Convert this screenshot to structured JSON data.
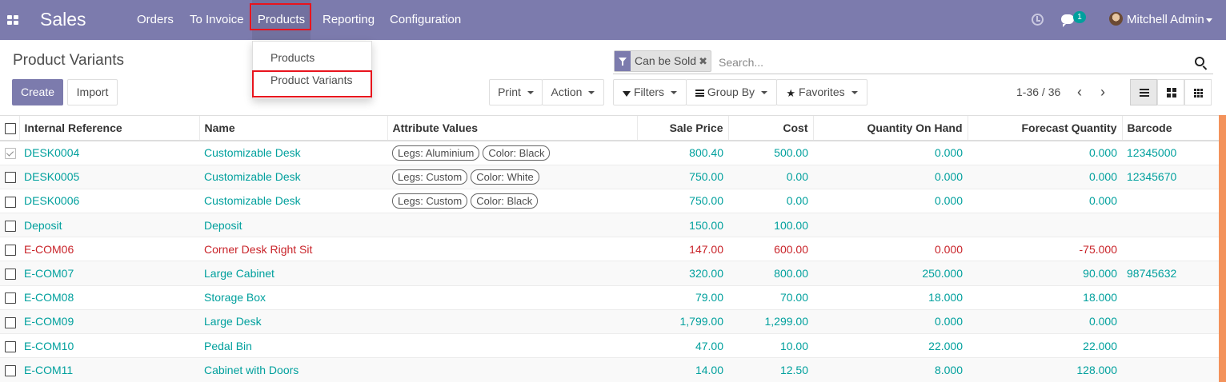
{
  "navbar": {
    "app_name": "Sales",
    "menu": [
      "Orders",
      "To Invoice",
      "Products",
      "Reporting",
      "Configuration"
    ],
    "chat_badge": "1",
    "user_name": "Mitchell Admin"
  },
  "dropdown": {
    "items": [
      "Products",
      "Product Variants"
    ]
  },
  "control_panel": {
    "title": "Product Variants",
    "create_label": "Create",
    "import_label": "Import",
    "print_label": "Print",
    "action_label": "Action",
    "filters_label": "Filters",
    "groupby_label": "Group By",
    "favorites_label": "Favorites",
    "search_facet": "Can be Sold",
    "search_placeholder": "Search...",
    "pager": "1-36 / 36"
  },
  "table": {
    "columns": [
      "Internal Reference",
      "Name",
      "Attribute Values",
      "Sale Price",
      "Cost",
      "Quantity On Hand",
      "Forecast Quantity",
      "Barcode"
    ],
    "rows": [
      {
        "ref": "DESK0004",
        "name": "Customizable Desk",
        "attributes": [
          "Legs: Aluminium",
          "Color: Black"
        ],
        "price": "800.40",
        "cost": "500.00",
        "qty": "0.000",
        "forecast": "0.000",
        "barcode": "12345000",
        "checked": true,
        "danger": false
      },
      {
        "ref": "DESK0005",
        "name": "Customizable Desk",
        "attributes": [
          "Legs: Custom",
          "Color: White"
        ],
        "price": "750.00",
        "cost": "0.00",
        "qty": "0.000",
        "forecast": "0.000",
        "barcode": "12345670",
        "checked": false,
        "danger": false
      },
      {
        "ref": "DESK0006",
        "name": "Customizable Desk",
        "attributes": [
          "Legs: Custom",
          "Color: Black"
        ],
        "price": "750.00",
        "cost": "0.00",
        "qty": "0.000",
        "forecast": "0.000",
        "barcode": "",
        "checked": false,
        "danger": false
      },
      {
        "ref": "Deposit",
        "name": "Deposit",
        "attributes": [],
        "price": "150.00",
        "cost": "100.00",
        "qty": "",
        "forecast": "",
        "barcode": "",
        "checked": false,
        "danger": false
      },
      {
        "ref": "E-COM06",
        "name": "Corner Desk Right Sit",
        "attributes": [],
        "price": "147.00",
        "cost": "600.00",
        "qty": "0.000",
        "forecast": "-75.000",
        "barcode": "",
        "checked": false,
        "danger": true
      },
      {
        "ref": "E-COM07",
        "name": "Large Cabinet",
        "attributes": [],
        "price": "320.00",
        "cost": "800.00",
        "qty": "250.000",
        "forecast": "90.000",
        "barcode": "98745632",
        "checked": false,
        "danger": false
      },
      {
        "ref": "E-COM08",
        "name": "Storage Box",
        "attributes": [],
        "price": "79.00",
        "cost": "70.00",
        "qty": "18.000",
        "forecast": "18.000",
        "barcode": "",
        "checked": false,
        "danger": false
      },
      {
        "ref": "E-COM09",
        "name": "Large Desk",
        "attributes": [],
        "price": "1,799.00",
        "cost": "1,299.00",
        "qty": "0.000",
        "forecast": "0.000",
        "barcode": "",
        "checked": false,
        "danger": false
      },
      {
        "ref": "E-COM10",
        "name": "Pedal Bin",
        "attributes": [],
        "price": "47.00",
        "cost": "10.00",
        "qty": "22.000",
        "forecast": "22.000",
        "barcode": "",
        "checked": false,
        "danger": false
      },
      {
        "ref": "E-COM11",
        "name": "Cabinet with Doors",
        "attributes": [],
        "price": "14.00",
        "cost": "12.50",
        "qty": "8.000",
        "forecast": "128.000",
        "barcode": "",
        "checked": false,
        "danger": false
      }
    ]
  },
  "colors": {
    "navbar_bg": "#7c7bad",
    "link": "#00a09d",
    "danger": "#c9242a",
    "highlight_box": "#e8141d",
    "scroll_accent": "#f3925b"
  }
}
